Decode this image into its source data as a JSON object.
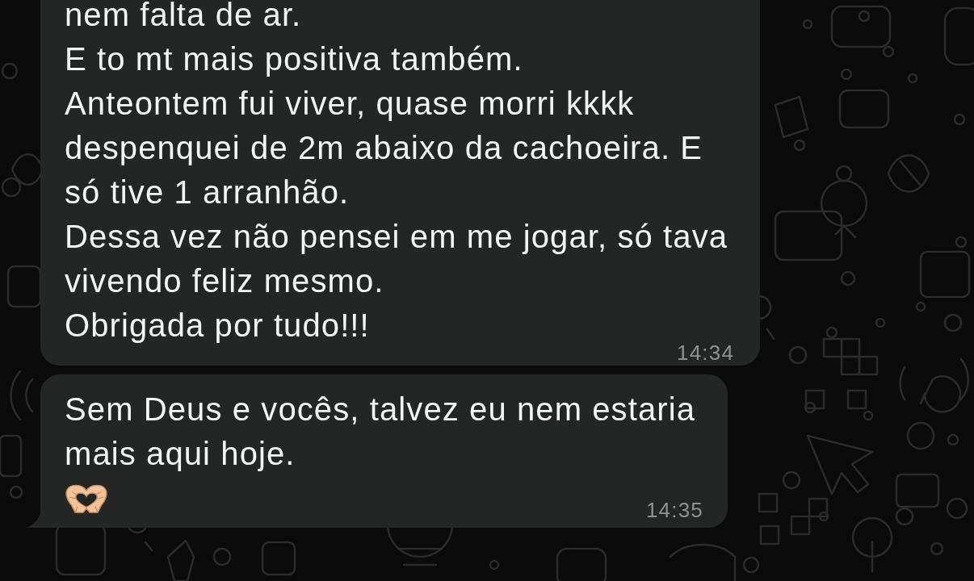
{
  "messages": [
    {
      "kind": "text",
      "lines": [
        "nem falta de ar.",
        "E to mt mais positiva também.",
        "Anteontem fui viver, quase morri kkkk",
        "despenquei de 2m abaixo da cachoeira. E",
        "só tive 1 arranhão.",
        "Dessa vez não pensei em me jogar, só tava",
        "vivendo feliz mesmo.",
        "Obrigada por tudo!!!"
      ],
      "time": "14:34",
      "tail": false
    },
    {
      "kind": "text_emoji",
      "lines": [
        "Sem Deus e vocês, talvez eu nem estaria",
        "mais aqui hoje."
      ],
      "time": "14:35",
      "tail": true
    }
  ]
}
